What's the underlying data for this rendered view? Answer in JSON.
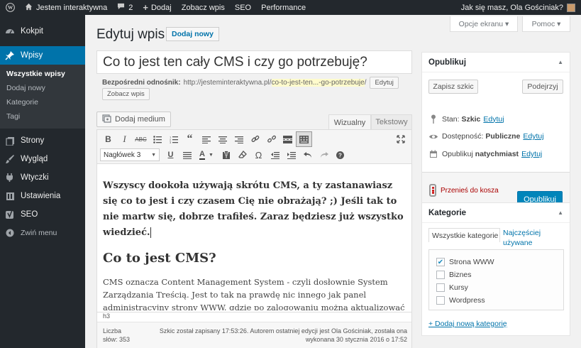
{
  "adminbar": {
    "site_name": "Jestem interaktywna",
    "comments_count": "2",
    "add_new": "Dodaj",
    "view_post": "Zobacz wpis",
    "seo": "SEO",
    "performance": "Performance",
    "greeting": "Jak się masz, Ola Gościniak?"
  },
  "sidebar": {
    "items": [
      {
        "label": "Kokpit",
        "icon": "dashboard-icon"
      },
      {
        "label": "Wpisy",
        "icon": "pin-icon"
      },
      {
        "label": "Strony",
        "icon": "pages-icon"
      },
      {
        "label": "Wygląd",
        "icon": "brush-icon"
      },
      {
        "label": "Wtyczki",
        "icon": "plugin-icon"
      },
      {
        "label": "Ustawienia",
        "icon": "settings-icon"
      },
      {
        "label": "SEO",
        "icon": "yoast-icon"
      },
      {
        "label": "Zwiń menu",
        "icon": "collapse-icon"
      }
    ],
    "submenu": [
      "Wszystkie wpisy",
      "Dodaj nowy",
      "Kategorie",
      "Tagi"
    ]
  },
  "header": {
    "screen_options": "Opcje ekranu ▾",
    "help": "Pomoc ▾",
    "title": "Edytuj wpis",
    "add_new": "Dodaj nowy"
  },
  "post": {
    "title": "Co to jest ten cały CMS i czy go potrzebuję?",
    "permalink_label": "Bezpośredni odnośnik:",
    "permalink_base": "http://jesteminteraktywna.pl/",
    "permalink_slug": "co-to-jest-ten...-go-potrzebuje",
    "permalink_trail": "/",
    "edit_btn": "Edytuj",
    "view_btn": "Zobacz wpis"
  },
  "editor": {
    "add_media": "Dodaj medium",
    "tab_visual": "Wizualny",
    "tab_text": "Tekstowy",
    "format": "Nagłówek 3",
    "lead": "Wszyscy dookoła używają skrótu CMS, a ty zastanawiasz się co to jest i czy czasem Cię nie obrażają? ;) Jeśli tak to nie martw się, dobrze trafiłeś. Zaraz będziesz już wszystko wiedzieć.",
    "heading": "Co to jest CMS?",
    "paragraph": "CMS oznacza Content Management System - czyli dosłownie System Zarządzania Treścią. Jest to tak na prawdę nic innego jak panel administracyjny strony WWW, gdzie po zalogowaniu można aktualizować treści zawarte na niej.",
    "path": "h3",
    "word_count_label": "Liczba",
    "word_count": "słów: 353",
    "autosave": "Szkic został zapisany 17:53:26. Autorem ostatniej edycji jest Ola Gościniak, została ona wykonana 30 stycznia 2016 o 17:52"
  },
  "publish": {
    "title": "Opublikuj",
    "save_draft": "Zapisz szkic",
    "preview": "Podejrzyj",
    "status_label": "Stan:",
    "status_value": "Szkic",
    "visibility_label": "Dostępność:",
    "visibility_value": "Publiczne",
    "schedule_label": "Opublikuj",
    "schedule_value": "natychmiast",
    "edit": "Edytuj",
    "trash": "Przenieś do kosza",
    "publish_btn": "Opublikuj"
  },
  "categories": {
    "title": "Kategorie",
    "tab_all": "Wszystkie kategorie",
    "tab_popular": "Najczęściej używane",
    "items": [
      {
        "label": "Strona WWW",
        "checked": true
      },
      {
        "label": "Biznes",
        "checked": false
      },
      {
        "label": "Kursy",
        "checked": false
      },
      {
        "label": "Wordpress",
        "checked": false
      }
    ],
    "add_new": "+ Dodaj nową kategorię"
  }
}
